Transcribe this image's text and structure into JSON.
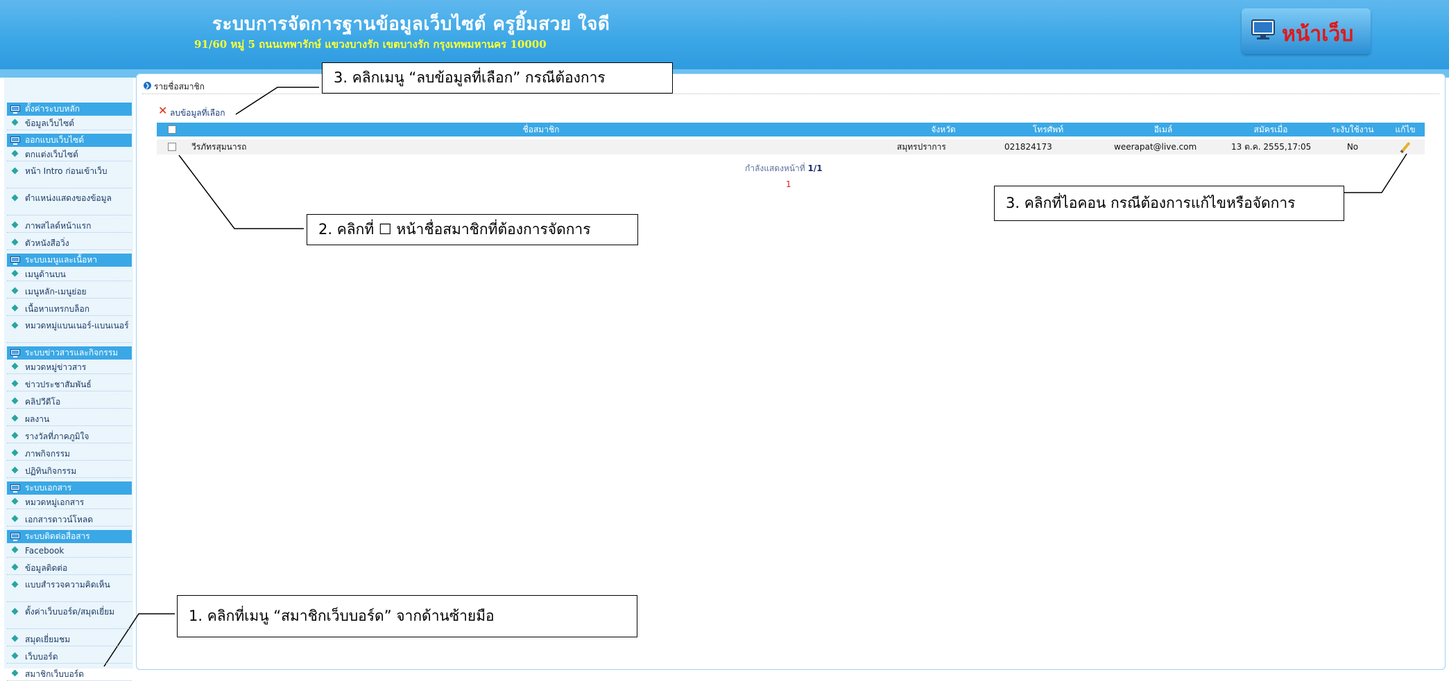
{
  "header": {
    "title": "ระบบการจัดการฐานข้อมูลเว็บไซต์ ครูยิ้มสวย ใจดี",
    "subtitle": "91/60 หมู่ 5 ถนนเทพารักษ์ แขวงบางรัก เขตบางรัก กรุงเทพมหานคร 10000",
    "web_button": "หน้าเว็บ"
  },
  "sidebar": {
    "items": [
      {
        "label": "ตั้งค่าระบบหลัก",
        "type": "header"
      },
      {
        "label": "ข้อมูลเว็บไซต์",
        "type": "item"
      },
      {
        "label": "ออกแบบเว็บไซต์",
        "type": "header"
      },
      {
        "label": "ตกแต่งเว็บไซต์",
        "type": "item"
      },
      {
        "label": "หน้า Intro ก่อนเข้าเว็บ",
        "type": "item"
      },
      {
        "label": "ตำแหน่งแสดงของข้อมูล",
        "type": "item"
      },
      {
        "label": "ภาพสไลด์หน้าแรก",
        "type": "item"
      },
      {
        "label": "ตัวหนังสือวิ่ง",
        "type": "item"
      },
      {
        "label": "ระบบเมนูและเนื้อหา",
        "type": "header"
      },
      {
        "label": "เมนูด้านบน",
        "type": "item"
      },
      {
        "label": "เมนูหลัก-เมนูย่อย",
        "type": "item"
      },
      {
        "label": "เนื้อหาแทรกบล็อก",
        "type": "item"
      },
      {
        "label": "หมวดหมู่แบนเนอร์-แบนเนอร์",
        "type": "item"
      },
      {
        "label": "ระบบข่าวสารและกิจกรรม",
        "type": "header"
      },
      {
        "label": "หมวดหมู่ข่าวสาร",
        "type": "item"
      },
      {
        "label": "ข่าวประชาสัมพันธ์",
        "type": "item"
      },
      {
        "label": "คลิปวีดีโอ",
        "type": "item"
      },
      {
        "label": "ผลงาน",
        "type": "item"
      },
      {
        "label": "รางวัลที่ภาคภูมิใจ",
        "type": "item"
      },
      {
        "label": "ภาพกิจกรรม",
        "type": "item"
      },
      {
        "label": "ปฏิทินกิจกรรม",
        "type": "item"
      },
      {
        "label": "ระบบเอกสาร",
        "type": "header"
      },
      {
        "label": "หมวดหมู่เอกสาร",
        "type": "item"
      },
      {
        "label": "เอกสารดาวน์โหลด",
        "type": "item"
      },
      {
        "label": "ระบบติดต่อสื่อสาร",
        "type": "header"
      },
      {
        "label": "Facebook",
        "type": "item"
      },
      {
        "label": "ข้อมูลติดต่อ",
        "type": "item"
      },
      {
        "label": "แบบสำรวจความคิดเห็น",
        "type": "item"
      },
      {
        "label": "ตั้งค่าเว็บบอร์ด/สมุดเยี่ยม",
        "type": "item"
      },
      {
        "label": "สมุดเยี่ยมชม",
        "type": "item"
      },
      {
        "label": "เว็บบอร์ด",
        "type": "item"
      },
      {
        "label": "สมาชิกเว็บบอร์ด",
        "type": "item"
      }
    ]
  },
  "main": {
    "breadcrumb": "รายชื่อสมาชิก",
    "delete_label": "ลบข้อมูลที่เลือก",
    "table": {
      "headers": [
        "ชื่อสมาชิก",
        "จังหวัด",
        "โทรศัพท์",
        "อีเมล์",
        "สมัครเมื่อ",
        "ระงับใช้งาน",
        "แก้ไข"
      ],
      "rows": [
        {
          "name": "วีรภัทรสุมนารถ",
          "province": "สมุทรปราการ",
          "phone": "021824173",
          "email": "weerapat@live.com",
          "joined": "13 ต.ค. 2555,17:05",
          "suspended": "No"
        }
      ]
    },
    "paging_label": "กำลังแสดงหน้าที่",
    "paging_value": "1/1",
    "page_number": "1"
  },
  "callouts": {
    "c1": "1. คลิกที่เมนู “สมาชิกเว็บบอร์ด” จากด้านซ้ายมือ",
    "c2": "2. คลิกที่ ☐ หน้าชื่อสมาชิกที่ต้องการจัดการ",
    "c3a": "3. คลิกเมนู  “ลบข้อมูลที่เลือก” กรณีต้องการ",
    "c3b": "3. คลิกที่ไอคอน กรณีต้องการแก้ไขหรือจัดการ"
  },
  "colors": {
    "header": "#3aa6e6",
    "title": "#ffffff",
    "subtitle": "#ffff33",
    "web_label": "#e11818",
    "sidebar_header": "#3aa8e6",
    "accent_delete": "#e52a1a"
  }
}
